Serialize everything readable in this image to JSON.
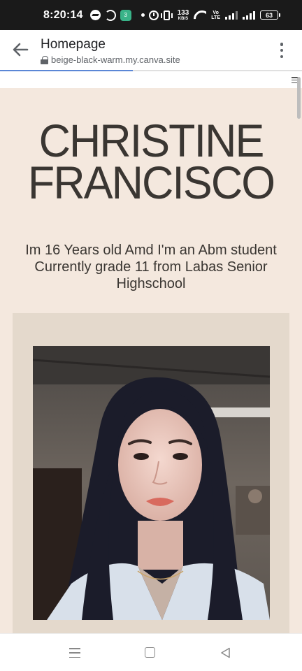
{
  "status_bar": {
    "time": "8:20:14",
    "net_speed": "133",
    "net_speed_unit": "KB/S",
    "volte_top": "Vo",
    "volte_bottom": "LTE",
    "battery": "63",
    "app_icon_text": "3"
  },
  "browser": {
    "title": "Homepage",
    "url": "beige-black-warm.my.canva.site",
    "load_progress": 0.44
  },
  "page": {
    "name_line1": "CHRISTINE",
    "name_line2": "FRANCISCO",
    "bio": "Im 16 Years old Amd I'm an Abm student Currently grade 11 from Labas Senior Highschool",
    "colors": {
      "background": "#f4e8de",
      "frame": "#e4d9cc",
      "text": "#3a3632"
    }
  },
  "nav": {
    "icons": [
      "menu-icon",
      "home-square-icon",
      "back-triangle-icon"
    ]
  }
}
